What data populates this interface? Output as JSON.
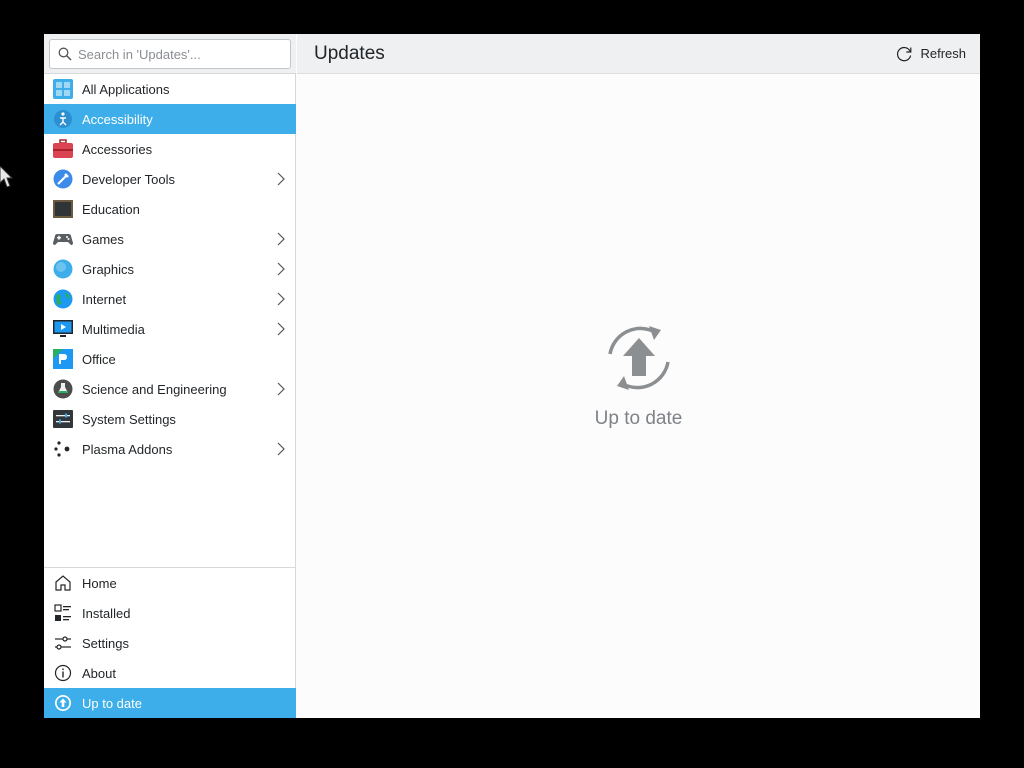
{
  "search": {
    "placeholder": "Search in 'Updates'..."
  },
  "categories": [
    {
      "label": "All Applications",
      "icon": "all-applications-icon",
      "submenu": false
    },
    {
      "label": "Accessibility",
      "icon": "accessibility-icon",
      "submenu": false,
      "active": true
    },
    {
      "label": "Accessories",
      "icon": "accessories-icon",
      "submenu": false
    },
    {
      "label": "Developer Tools",
      "icon": "developer-tools-icon",
      "submenu": true
    },
    {
      "label": "Education",
      "icon": "education-icon",
      "submenu": false
    },
    {
      "label": "Games",
      "icon": "games-icon",
      "submenu": true
    },
    {
      "label": "Graphics",
      "icon": "graphics-icon",
      "submenu": true
    },
    {
      "label": "Internet",
      "icon": "internet-icon",
      "submenu": true
    },
    {
      "label": "Multimedia",
      "icon": "multimedia-icon",
      "submenu": true
    },
    {
      "label": "Office",
      "icon": "office-icon",
      "submenu": false
    },
    {
      "label": "Science and Engineering",
      "icon": "science-icon",
      "submenu": true
    },
    {
      "label": "System Settings",
      "icon": "system-settings-icon",
      "submenu": false
    },
    {
      "label": "Plasma Addons",
      "icon": "plasma-addons-icon",
      "submenu": true
    }
  ],
  "bottom_nav": [
    {
      "label": "Home",
      "icon": "home-icon"
    },
    {
      "label": "Installed",
      "icon": "installed-icon"
    },
    {
      "label": "Settings",
      "icon": "settings-icon"
    },
    {
      "label": "About",
      "icon": "about-icon"
    }
  ],
  "status": {
    "label": "Up to date",
    "icon": "up-to-date-icon"
  },
  "header": {
    "title": "Updates",
    "refresh_label": "Refresh"
  },
  "main": {
    "empty_text": "Up to date"
  },
  "colors": {
    "accent": "#3daee9",
    "sidebar_bg": "#ffffff",
    "header_bg": "#eff0f1",
    "content_bg": "#fcfcfc"
  }
}
